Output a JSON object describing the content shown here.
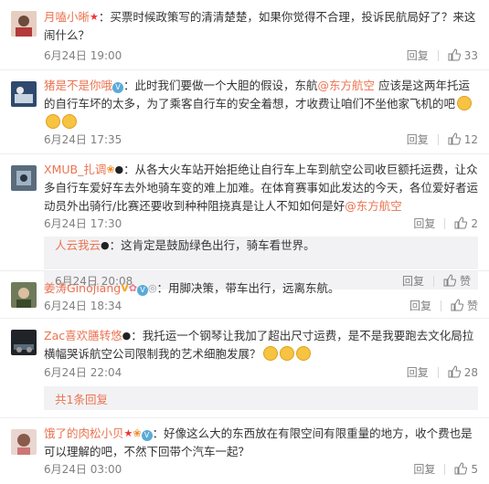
{
  "comments": [
    {
      "user": "月嗑小晰",
      "text": "：买票时候政策写的清清楚楚，如果你觉得不合理，投诉民航局好了？来这闹什么？",
      "time": "6月24日 19:00",
      "reply_label": "回复",
      "likes": "33"
    },
    {
      "user": "猪是不是你哦",
      "text_a": "：此时我们要做一个大胆的假设，东航",
      "mention": "@东方航空",
      "text_b": " 应该是这两年托运的自行车坏的太多，为了乘客自行车的安全着想，才收费让咱们不坐他家飞机的吧",
      "time": "6月24日 17:35",
      "reply_label": "回复",
      "likes": "12"
    },
    {
      "user": "XMUB_扎调",
      "text_a": "：从各大火车站开始拒绝让自行车上车到航空公司收巨额托运费，让众多自行车爱好车去外地骑车变的难上加难。在体育赛事如此发达的今天，各位爱好者运动员外出骑行/比赛还要收到种种阻挠真是让人不知如何是好",
      "mention": "@东方航空",
      "time": "6月24日 17:30",
      "reply_label": "回复",
      "likes": "2",
      "sub_reply": {
        "user": "人云我云",
        "text": "：这肯定是鼓励绿色出行，骑车看世界。",
        "time": "6月24日 20:08",
        "reply_label": "回复",
        "like_label": "赞"
      }
    },
    {
      "user": "姜涛Ginojiang",
      "text": "：用脚决策，带车出行，远离东航。",
      "time": "6月24日 18:34",
      "reply_label": "回复",
      "like_label": "赞"
    },
    {
      "user": "Zac喜欢膳转悠",
      "text": "：我托运一个钢琴让我加了超出尺寸运费，是不是我要跑去文化局拉横幅哭诉航空公司限制我的艺术细胞发展？",
      "time": "6月24日 22:04",
      "reply_label": "回复",
      "likes": "28",
      "more_replies": "共1条回复"
    },
    {
      "user": "饿了的肉松小贝",
      "text": "：好像这么大的东西放在有限空间有限重量的地方，收个费也是可以理解的吧，不然下回带个汽车一起？",
      "time": "6月24日 03:00",
      "reply_label": "回复",
      "likes": "5"
    }
  ],
  "colors": {
    "link": "#eb7350",
    "meta": "#808080",
    "reply_bg": "#f2f2f5"
  }
}
